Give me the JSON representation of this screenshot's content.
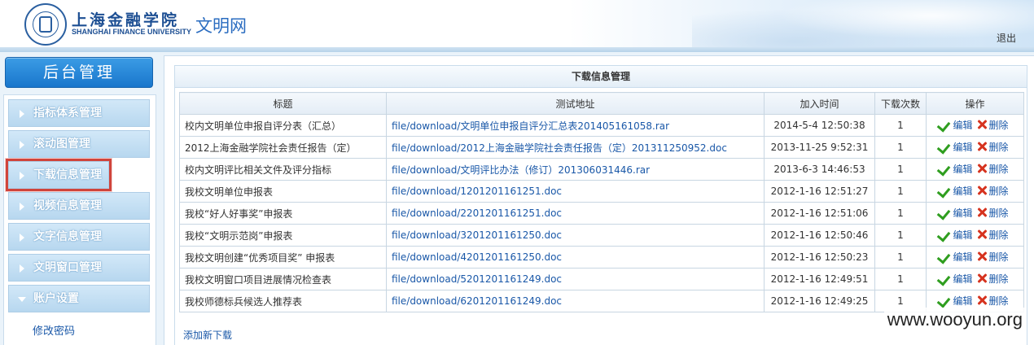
{
  "header": {
    "logo_cn": "上海金融学院",
    "logo_en": "SHANGHAI FINANCE UNIVERSITY",
    "site_title": "文明网",
    "logout": "退出"
  },
  "sidebar": {
    "title": "后台管理",
    "items": [
      {
        "label": "指标体系管理"
      },
      {
        "label": "滚动图管理"
      },
      {
        "label": "下载信息管理"
      },
      {
        "label": "视频信息管理"
      },
      {
        "label": "文字信息管理"
      },
      {
        "label": "文明窗口管理"
      },
      {
        "label": "账户设置"
      }
    ],
    "subitem": "修改密码"
  },
  "main": {
    "panel_title": "下载信息管理",
    "columns": [
      "标题",
      "测试地址",
      "加入时间",
      "下载次数",
      "操作"
    ],
    "edit_label": "编辑",
    "delete_label": "删除",
    "add_link": "添加新下载",
    "rows": [
      {
        "title": "校内文明单位申报自评分表（汇总）",
        "url": "file/download/文明单位申报自评分汇总表201405161058.rar",
        "time": "2014-5-4 12:50:38",
        "count": "1"
      },
      {
        "title": "2012上海金融学院社会责任报告（定）",
        "url": "file/download/2012上海金融学院社会责任报告（定）201311250952.doc",
        "time": "2013-11-25 9:52:31",
        "count": "1"
      },
      {
        "title": "校内文明评比相关文件及评分指标",
        "url": "file/download/文明评比办法（修订）201306031446.rar",
        "time": "2013-6-3 14:46:53",
        "count": "1"
      },
      {
        "title": "我校文明单位申报表",
        "url": "file/download/1201201161251.doc",
        "time": "2012-1-16 12:51:27",
        "count": "1"
      },
      {
        "title": "我校“好人好事奖”申报表",
        "url": "file/download/2201201161251.doc",
        "time": "2012-1-16 12:51:06",
        "count": "1"
      },
      {
        "title": "我校“文明示范岗”申报表",
        "url": "file/download/3201201161250.doc",
        "time": "2012-1-16 12:50:46",
        "count": "1"
      },
      {
        "title": "我校文明创建“优秀项目奖” 申报表",
        "url": "file/download/4201201161250.doc",
        "time": "2012-1-16 12:50:23",
        "count": "1"
      },
      {
        "title": "我校文明窗口项目进展情况检查表",
        "url": "file/download/5201201161249.doc",
        "time": "2012-1-16 12:49:51",
        "count": "1"
      },
      {
        "title": "我校师德标兵候选人推荐表",
        "url": "file/download/6201201161249.doc",
        "time": "2012-1-16 12:49:25",
        "count": "1"
      }
    ]
  },
  "watermark": "www.wooyun.org"
}
